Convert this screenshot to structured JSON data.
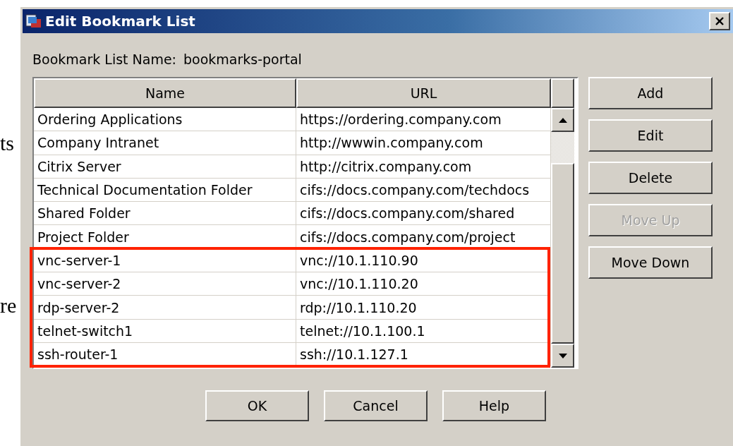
{
  "background_text": [
    "ts",
    "re"
  ],
  "window": {
    "title": "Edit Bookmark List"
  },
  "list_name": {
    "label": "Bookmark List Name:",
    "value": "bookmarks-portal"
  },
  "table": {
    "columns": [
      "Name",
      "URL"
    ],
    "rows": [
      {
        "name": "Ordering Applications",
        "url": "https://ordering.company.com",
        "highlighted": false
      },
      {
        "name": "Company Intranet",
        "url": "http://wwwin.company.com",
        "highlighted": false
      },
      {
        "name": "Citrix Server",
        "url": "http://citrix.company.com",
        "highlighted": false
      },
      {
        "name": "Technical Documentation Folder",
        "url": "cifs://docs.company.com/techdocs",
        "highlighted": false
      },
      {
        "name": "Shared Folder",
        "url": "cifs://docs.company.com/shared",
        "highlighted": false
      },
      {
        "name": "Project Folder",
        "url": "cifs://docs.company.com/project",
        "highlighted": false
      },
      {
        "name": "vnc-server-1",
        "url": "vnc://10.1.110.90",
        "highlighted": true
      },
      {
        "name": "vnc-server-2",
        "url": "vnc://10.1.110.20",
        "highlighted": true
      },
      {
        "name": "rdp-server-2",
        "url": "rdp://10.1.110.20",
        "highlighted": true
      },
      {
        "name": "telnet-switch1",
        "url": "telnet://10.1.100.1",
        "highlighted": true
      },
      {
        "name": "ssh-router-1",
        "url": "ssh://10.1.127.1",
        "highlighted": true
      }
    ]
  },
  "side_buttons": [
    {
      "label": "Add",
      "disabled": false
    },
    {
      "label": "Edit",
      "disabled": false
    },
    {
      "label": "Delete",
      "disabled": false
    },
    {
      "label": "Move Up",
      "disabled": true
    },
    {
      "label": "Move Down",
      "disabled": false
    }
  ],
  "buttons": [
    {
      "label": "OK"
    },
    {
      "label": "Cancel"
    },
    {
      "label": "Help"
    }
  ]
}
